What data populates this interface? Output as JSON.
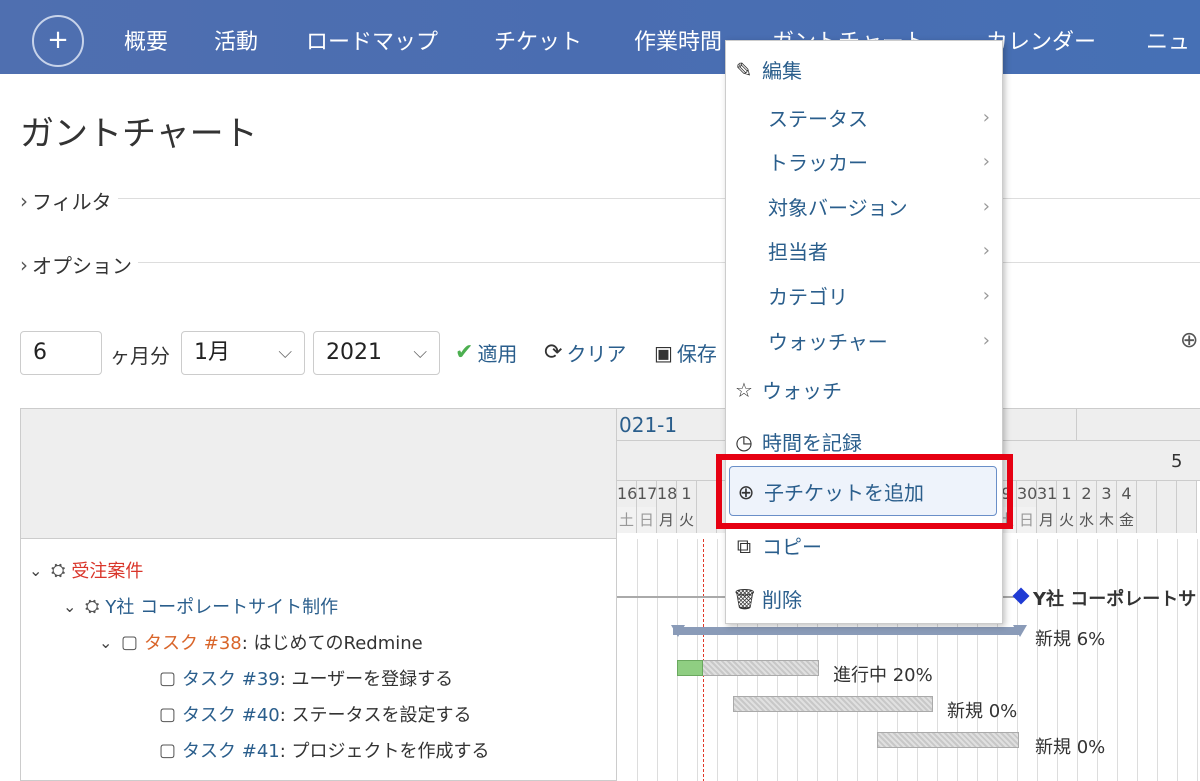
{
  "nav": {
    "plus": "+",
    "items": [
      "概要",
      "活動",
      "ロードマップ",
      "チケット",
      "作業時間",
      "ガントチャート",
      "カレンダー",
      "ニュ"
    ]
  },
  "page": {
    "title": "ガントチャート",
    "filter_label": "フィルタ",
    "options_label": "オプション"
  },
  "controls": {
    "months_value": "6",
    "months_label": "ヶ月分",
    "month_select": "1月",
    "year_select": "2021",
    "apply": "適用",
    "clear": "クリア",
    "save": "保存"
  },
  "tree": [
    {
      "label": "受注案件",
      "kind": "project"
    },
    {
      "label": "Y社 コーポレートサイト制作",
      "kind": "project"
    },
    {
      "tracker": "タスク #38",
      "subject": ": はじめてのRedmine"
    },
    {
      "tracker": "タスク #39",
      "subject": ": ユーザーを登録する"
    },
    {
      "tracker": "タスク #40",
      "subject": ": ステータスを設定する"
    },
    {
      "tracker": "タスク #41",
      "subject": ": プロジェクトを作成する"
    }
  ],
  "gantt": {
    "month_label": "021-1",
    "next_month_label": "5",
    "days": [
      "16",
      "17",
      "18",
      "1",
      "",
      "",
      "",
      "",
      "",
      "",
      "",
      "",
      "",
      "",
      "",
      "",
      "",
      "9",
      "30",
      "31",
      "1",
      "2",
      "3",
      "4"
    ],
    "dows": [
      "土",
      "日",
      "月",
      "火",
      "",
      "",
      "",
      "",
      "",
      "",
      "",
      "",
      "",
      "",
      "",
      "",
      "",
      "",
      "土",
      "日",
      "月",
      "火",
      "水",
      "木",
      "金"
    ],
    "project_label": "Y社 コーポレートサ",
    "status_labels": [
      "新規 6%",
      "進行中 20%",
      "新規 0%",
      "新規 0%"
    ]
  },
  "context_menu": {
    "edit": "編集",
    "submenus": [
      "ステータス",
      "トラッカー",
      "対象バージョン",
      "担当者",
      "カテゴリ",
      "ウォッチャー"
    ],
    "watch": "ウォッチ",
    "log_time": "時間を記録",
    "add_subtask": "子チケットを追加",
    "copy": "コピー",
    "delete": "削除"
  }
}
